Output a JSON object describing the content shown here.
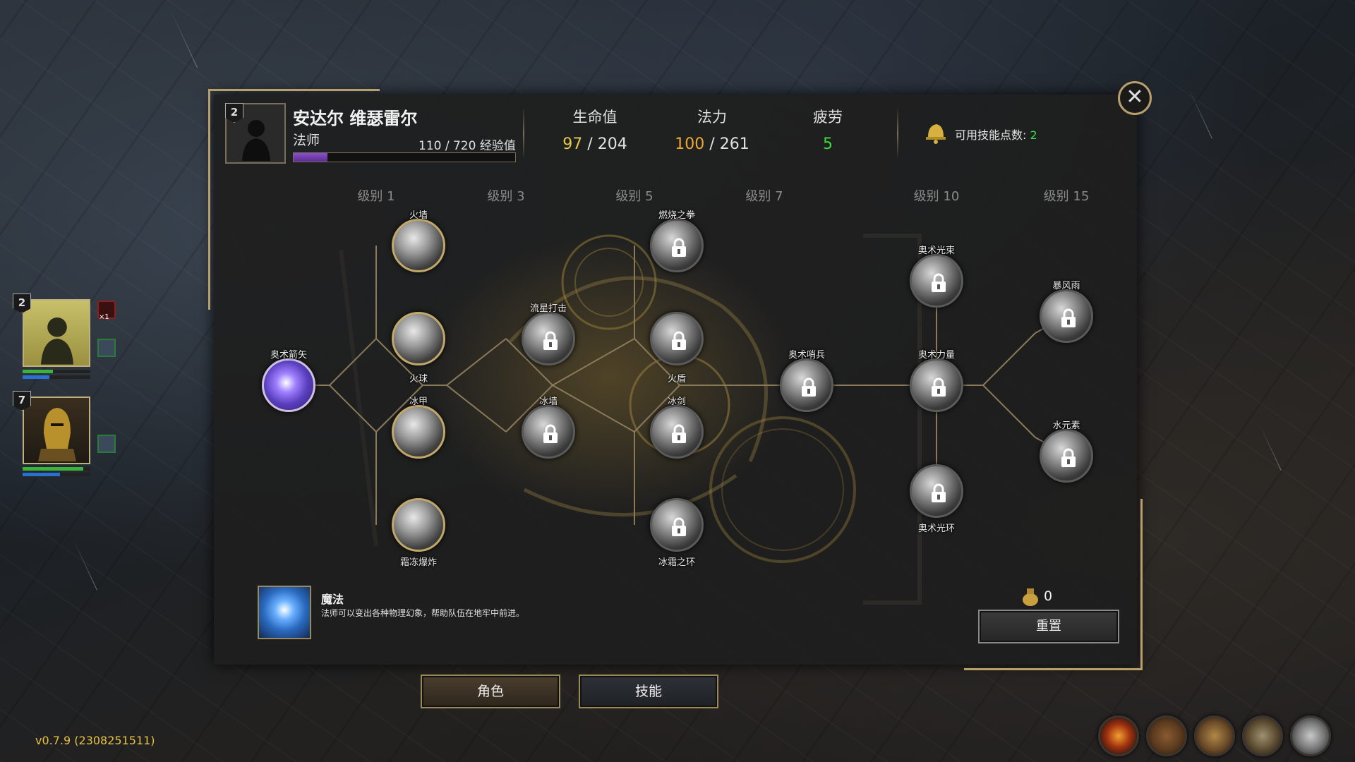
{
  "character": {
    "level": "2",
    "name": "安达尔 维瑟雷尔",
    "class": "法师",
    "xp_text": "110 / 720 经验值",
    "xp_progress": 0.153
  },
  "stats": {
    "hp": {
      "label": "生命值",
      "current": "97",
      "max": "204",
      "color": "#e6c84a"
    },
    "mana": {
      "label": "法力",
      "current": "100",
      "max": "261",
      "color": "#f0a830"
    },
    "fatigue": {
      "label": "疲劳",
      "value": "5",
      "color": "#3cdc3c"
    }
  },
  "skill_points": {
    "label": "可用技能点数: ",
    "value": "2",
    "color": "#3cdc3c"
  },
  "levels": [
    "级别 1",
    "级别 3",
    "级别 5",
    "级别 7",
    "级别 10",
    "级别 15"
  ],
  "skills": {
    "arcane_arrow": "奥术箭矢",
    "fire_wall": "火墙",
    "fireball": "火球",
    "ice_armor": "冰甲",
    "frost_blast": "霜冻爆炸",
    "meteor_strike": "流星打击",
    "ice_wall": "冰墙",
    "burning_fist": "燃烧之拳",
    "fire_shield": "火盾",
    "ice_sword": "冰剑",
    "frost_ring": "冰霜之环",
    "arcane_sentinel": "奥术哨兵",
    "arcane_beam": "奥术光束",
    "arcane_power": "奥术力量",
    "arcane_halo": "奥术光环",
    "storm": "暴风雨",
    "water_elemental": "水元素"
  },
  "description": {
    "title": "魔法",
    "text": "法师可以变出各种物理幻象，帮助队伍在地牢中前进。"
  },
  "gold": "0",
  "reset_label": "重置",
  "tabs": {
    "character": "角色",
    "skills": "技能"
  },
  "party": [
    {
      "level": "2",
      "hp": 0.45,
      "mana": 0.4,
      "stack": "×1"
    },
    {
      "level": "7",
      "hp": 0.9,
      "mana": 0.55
    }
  ],
  "version": "v0.7.9 (2308251511)",
  "icons": [
    "campfire-icon",
    "backpack-icon",
    "spellbook-icon",
    "map-icon",
    "settings-gear-icon"
  ]
}
